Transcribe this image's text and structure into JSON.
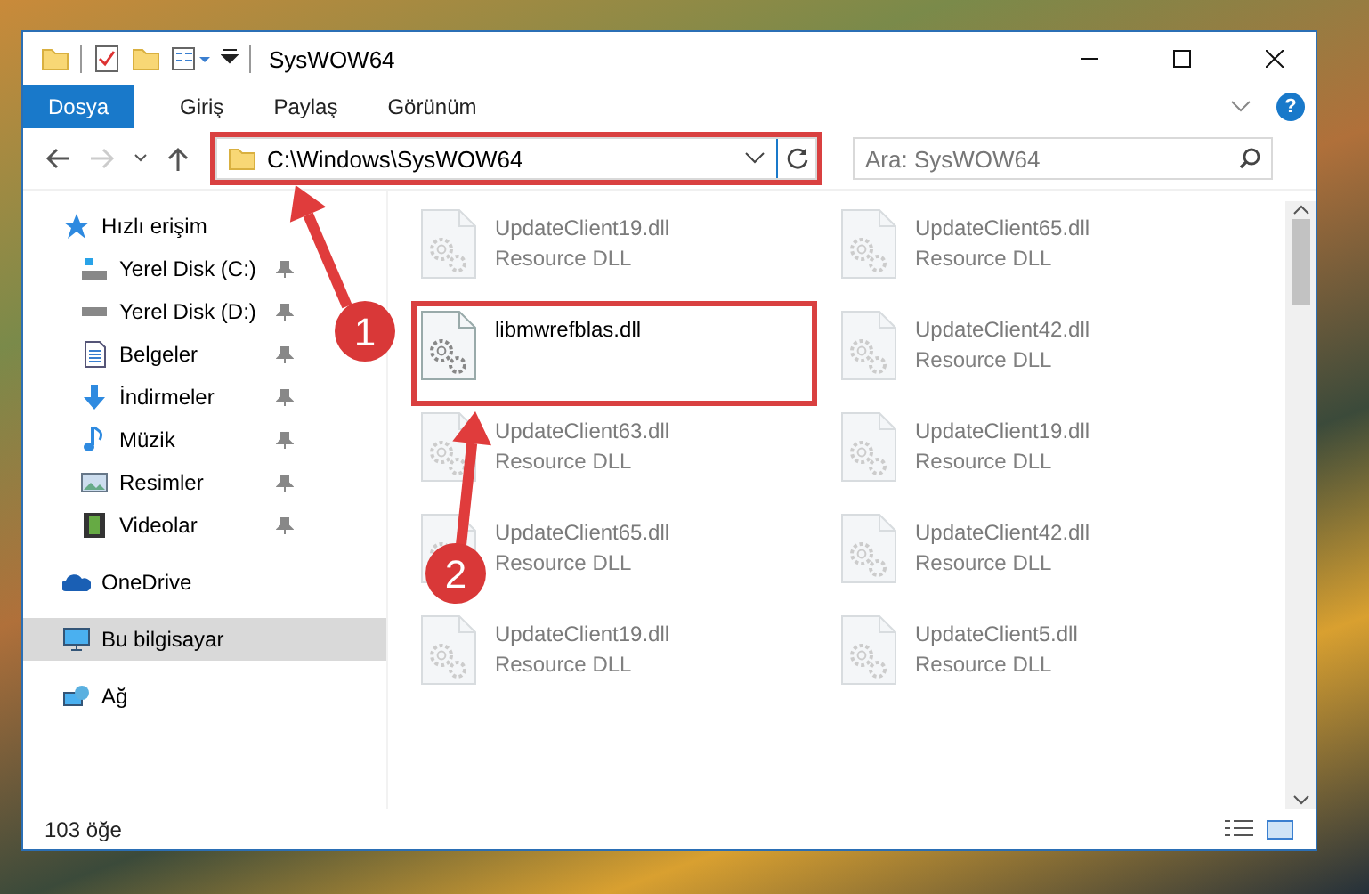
{
  "window": {
    "title": "SysWOW64"
  },
  "ribbon_tabs": [
    {
      "label": "Dosya",
      "kind": "file"
    },
    {
      "label": "Giriş",
      "kind": "tab"
    },
    {
      "label": "Paylaş",
      "kind": "tab"
    },
    {
      "label": "Görünüm",
      "kind": "tab"
    }
  ],
  "help": {
    "label": "?"
  },
  "navigation": {
    "forward_disabled": true
  },
  "address_bar": {
    "path": "C:\\Windows\\SysWOW64",
    "highlighted": true
  },
  "search": {
    "placeholder": "Ara: SysWOW64"
  },
  "sidebar": {
    "items": [
      {
        "label": "Hızlı erişim",
        "kind": "star",
        "selected": false,
        "children": [
          {
            "label": "Yerel Disk (C:)",
            "kind": "drive",
            "pinned": true
          },
          {
            "label": "Yerel Disk (D:)",
            "kind": "disk",
            "pinned": true
          },
          {
            "label": "Belgeler",
            "kind": "document",
            "pinned": true
          },
          {
            "label": "İndirmeler",
            "kind": "download",
            "pinned": true
          },
          {
            "label": "Müzik",
            "kind": "music",
            "pinned": true
          },
          {
            "label": "Resimler",
            "kind": "pictures",
            "pinned": true
          },
          {
            "label": "Videolar",
            "kind": "video",
            "pinned": true
          }
        ]
      },
      {
        "label": "OneDrive",
        "kind": "cloud",
        "selected": false
      },
      {
        "label": "Bu bilgisayar",
        "kind": "computer",
        "selected": true
      },
      {
        "label": "Ağ",
        "kind": "network",
        "selected": false
      }
    ]
  },
  "files": [
    {
      "name": "UpdateClient19.dll",
      "type": "Resource DLL",
      "dimmed": true,
      "highlighted": false
    },
    {
      "name": "UpdateClient65.dll",
      "type": "Resource DLL",
      "dimmed": true,
      "highlighted": false
    },
    {
      "name": "libmwrefblas.dll",
      "dimmed": false,
      "highlighted": true
    },
    {
      "name": "UpdateClient42.dll",
      "type": "Resource DLL",
      "dimmed": true,
      "highlighted": false
    },
    {
      "name": "UpdateClient63.dll",
      "type": "Resource DLL",
      "dimmed": true,
      "highlighted": false
    },
    {
      "name": "UpdateClient19.dll",
      "type": "Resource DLL",
      "dimmed": true,
      "highlighted": false
    },
    {
      "name": "UpdateClient65.dll",
      "type": "Resource DLL",
      "dimmed": true,
      "highlighted": false
    },
    {
      "name": "UpdateClient42.dll",
      "type": "Resource DLL",
      "dimmed": true,
      "highlighted": false
    },
    {
      "name": "UpdateClient19.dll",
      "type": "Resource DLL",
      "dimmed": true,
      "highlighted": false
    },
    {
      "name": "UpdateClient5.dll",
      "type": "Resource DLL",
      "dimmed": true,
      "highlighted": false
    }
  ],
  "status_bar": {
    "count": "103 öğe"
  },
  "annotations": [
    {
      "number": "1"
    },
    {
      "number": "2"
    }
  ]
}
